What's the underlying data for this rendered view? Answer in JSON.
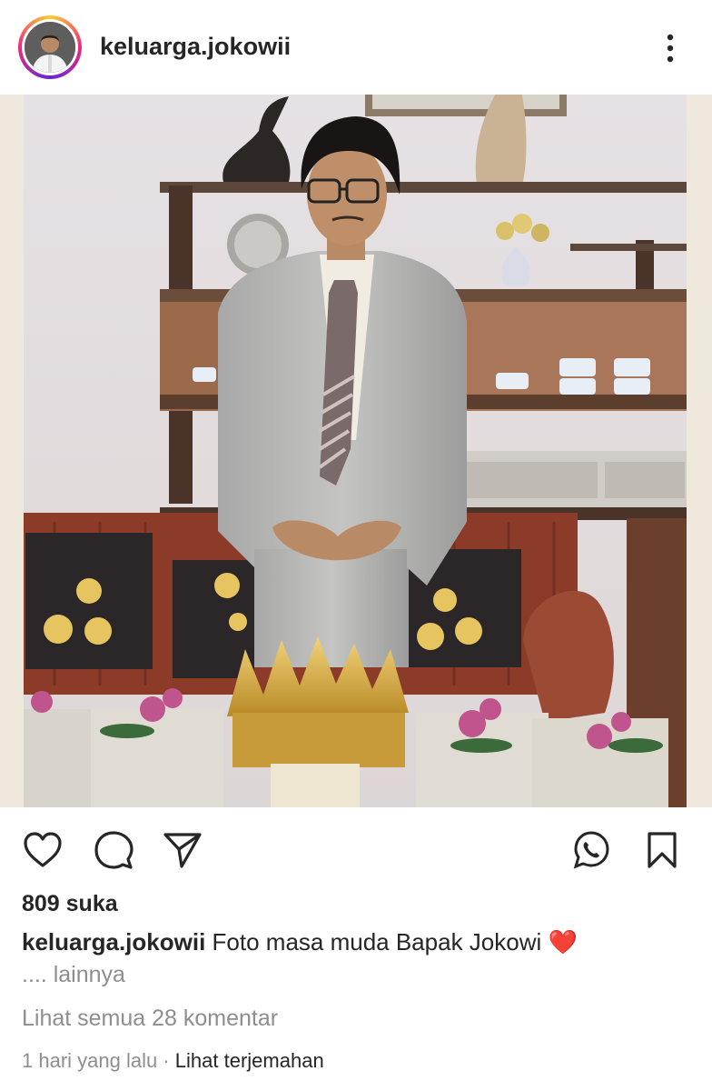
{
  "post": {
    "username": "keluarga.jokowii",
    "likes": "809 suka",
    "caption_user": "keluarga.jokowii",
    "caption_text": "Foto masa muda Bapak Jokowi",
    "caption_emoji": "❤️",
    "more": ".... lainnya",
    "view_comments": "Lihat semua 28 komentar",
    "time": "1 hari yang lalu",
    "separator": "·",
    "translate": "Lihat terjemahan"
  },
  "icons": {
    "like": "heart-icon",
    "comment": "comment-icon",
    "share": "send-icon",
    "whatsapp": "whatsapp-icon",
    "save": "bookmark-icon",
    "menu": "more-vertical-icon"
  },
  "colors": {
    "text": "#262626",
    "muted": "#8e8e8e",
    "heart": "#e0172b"
  }
}
